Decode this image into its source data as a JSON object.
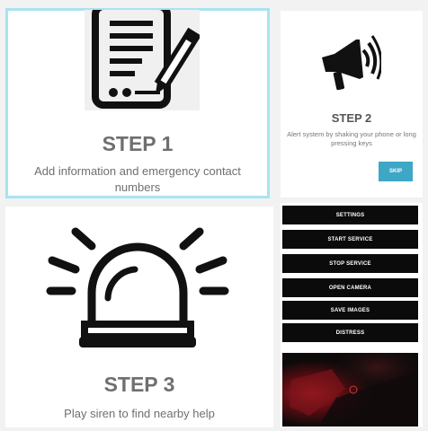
{
  "step1": {
    "title": "STEP 1",
    "description": "Add information and emergency contact numbers",
    "icon": "document-edit-icon"
  },
  "step2": {
    "title": "STEP 2",
    "description": "Alert system by shaking your phone or long pressing keys",
    "icon": "megaphone-icon",
    "skip_label": "SKIP"
  },
  "step3": {
    "title": "STEP 3",
    "description": "Play siren to find nearby help",
    "icon": "siren-icon"
  },
  "menu": {
    "buttons": [
      {
        "label": "SETTINGS"
      },
      {
        "label": "START SERVICE"
      },
      {
        "label": "STOP SERVICE"
      },
      {
        "label": "OPEN CAMERA"
      },
      {
        "label": "SAVE IMAGES"
      },
      {
        "label": "DISTRESS"
      }
    ]
  },
  "colors": {
    "accent": "#3ea7c6",
    "highlight_border": "#a9e3ef",
    "button_bg": "#0b0b0b"
  }
}
